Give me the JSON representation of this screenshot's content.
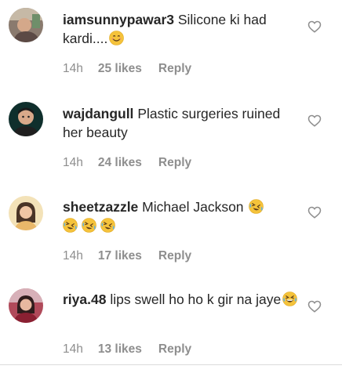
{
  "comments": [
    {
      "username": "iamsunnypawar3",
      "text": "Silicone ki had kardi....",
      "emoji": [
        "smiling-face-emoji"
      ],
      "time": "14h",
      "likes": "25 likes",
      "reply": "Reply",
      "avatar_color": "#8a7a6e"
    },
    {
      "username": "wajdangull",
      "text": "Plastic surgeries ruined her beauty",
      "emoji": [],
      "time": "14h",
      "likes": "24 likes",
      "reply": "Reply",
      "avatar_color": "#0f2f2c"
    },
    {
      "username": "sheetzazzle",
      "text": "Michael Jackson",
      "emoji": [
        "rolling-on-floor-laughing-emoji",
        "rolling-on-floor-laughing-emoji",
        "rolling-on-floor-laughing-emoji",
        "rolling-on-floor-laughing-emoji"
      ],
      "time": "14h",
      "likes": "17 likes",
      "reply": "Reply",
      "avatar_color": "#f3e2b8"
    },
    {
      "username": "riya.48",
      "text": "lips swell ho ho k gir na jaye",
      "emoji": [
        "grinning-squinting-tears-emoji"
      ],
      "time": "14h",
      "likes": "13 likes",
      "reply": "Reply",
      "avatar_color": "#b04a5a"
    }
  ],
  "colors": {
    "text": "#262626",
    "meta": "#8e8e8e",
    "heart": "#8e8e8e",
    "emoji_face": "#f5c33b"
  }
}
